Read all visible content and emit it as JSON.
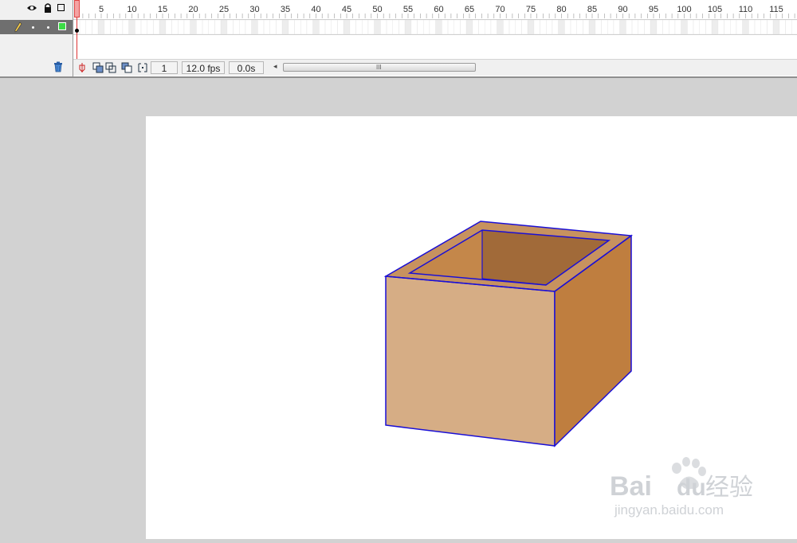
{
  "timeline": {
    "ruler_labels": [
      "1",
      "5",
      "10",
      "15",
      "20",
      "25",
      "30",
      "35",
      "40",
      "45",
      "50",
      "55",
      "60",
      "65",
      "70",
      "75",
      "80",
      "85",
      "90",
      "95",
      "100",
      "105",
      "110",
      "115"
    ],
    "current_frame": "1",
    "frame_rate": "12.0 fps",
    "elapsed_time": "0.0s",
    "scroll_grip": "III"
  },
  "layer": {
    "color": "#3cdc46"
  },
  "icons": {
    "header": [
      "eye-icon",
      "lock-icon",
      "outline-icon"
    ],
    "layer": [
      "pencil-icon"
    ],
    "footer": [
      "trash-icon"
    ],
    "toolbar": [
      "center-frame-icon",
      "onion-skin-icon",
      "onion-skin-outlines-icon",
      "edit-multiple-frames-icon",
      "modify-markers-icon"
    ]
  },
  "stage": {
    "background": "#ffffff",
    "pasteboard": "#d2d2d2",
    "box_colors": {
      "front": "#d6ad85",
      "side": "#bf7e3f",
      "rim": "#c7925f",
      "inside_back": "#a16a39",
      "inside_left": "#c4874a",
      "outline": "#1a0fd6"
    }
  },
  "watermark": {
    "brand": "Bai",
    "brand2": "du",
    "cn": "经验",
    "url": "jingyan.baidu.com"
  }
}
